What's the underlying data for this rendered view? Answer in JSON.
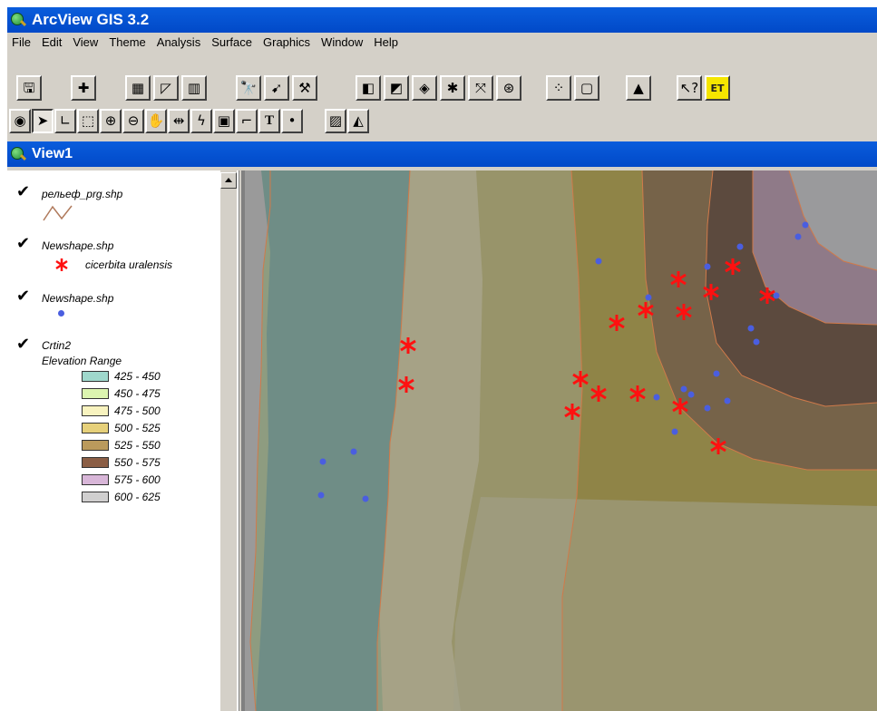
{
  "window_title": "ArcView GIS 3.2",
  "menu": [
    "File",
    "Edit",
    "View",
    "Theme",
    "Analysis",
    "Surface",
    "Graphics",
    "Window",
    "Help"
  ],
  "view_title": "View1",
  "toolbar1_buttons": [
    "save-icon",
    "add-theme-icon",
    "theme-properties-icon",
    "edit-legend-icon",
    "table-icon",
    "find-icon",
    "locate-address-icon",
    "query-builder-icon",
    "zoom-to-full-extent-icon",
    "zoom-to-themes-icon",
    "zoom-to-selected-icon",
    "zoom-in-icon",
    "zoom-out-icon",
    "zoom-previous-icon",
    "select-features-icon",
    "clear-selected-icon",
    "area-of-interest-icon",
    "help-icon",
    "et-extension-icon"
  ],
  "toolbar2_buttons": [
    "identify-icon",
    "pointer-icon",
    "vertex-edit-icon",
    "select-feature-icon",
    "zoom-in-tool-icon",
    "zoom-out-tool-icon",
    "pan-icon",
    "measure-icon",
    "hot-link-icon",
    "label-icon",
    "callout-icon",
    "text-icon",
    "draw-point-icon",
    "contour-icon",
    "cut-fill-icon"
  ],
  "et_label": "ET",
  "text_tool_label": "T",
  "legend": {
    "layers": [
      {
        "name": "рельеф_prg.shp",
        "checked": true,
        "symbol": "line-icon",
        "line_color": "#b07a5c"
      },
      {
        "name": "Newshape.shp",
        "checked": true,
        "symbol_label": "cicerbita uralensis",
        "symbol": "red-asterisk-icon",
        "color": "#ff1010"
      },
      {
        "name": "Newshape.shp",
        "checked": true,
        "symbol": "blue-point-icon",
        "color": "#4a5ee0"
      },
      {
        "name": "Crtin2",
        "checked": true,
        "subtitle": "Elevation Range",
        "classes": [
          {
            "label": "425 - 450",
            "color": "#9fd8cc"
          },
          {
            "label": "450 - 475",
            "color": "#dcf5b0"
          },
          {
            "label": "475 - 500",
            "color": "#f8f3bf"
          },
          {
            "label": "500 - 525",
            "color": "#e6d07a"
          },
          {
            "label": "525 - 550",
            "color": "#ba9a5c"
          },
          {
            "label": "550 - 575",
            "color": "#8b5e45"
          },
          {
            "label": "575 - 600",
            "color": "#d8b6d8"
          },
          {
            "label": "600 - 625",
            "color": "#d0cfcf"
          }
        ]
      }
    ]
  },
  "colors": {
    "title_bar": "#0149c8",
    "window_bg": "#d4d0c8",
    "contour_line": "#d07a4a",
    "asterisk": "#ff1010",
    "point": "#4a5ee0"
  }
}
